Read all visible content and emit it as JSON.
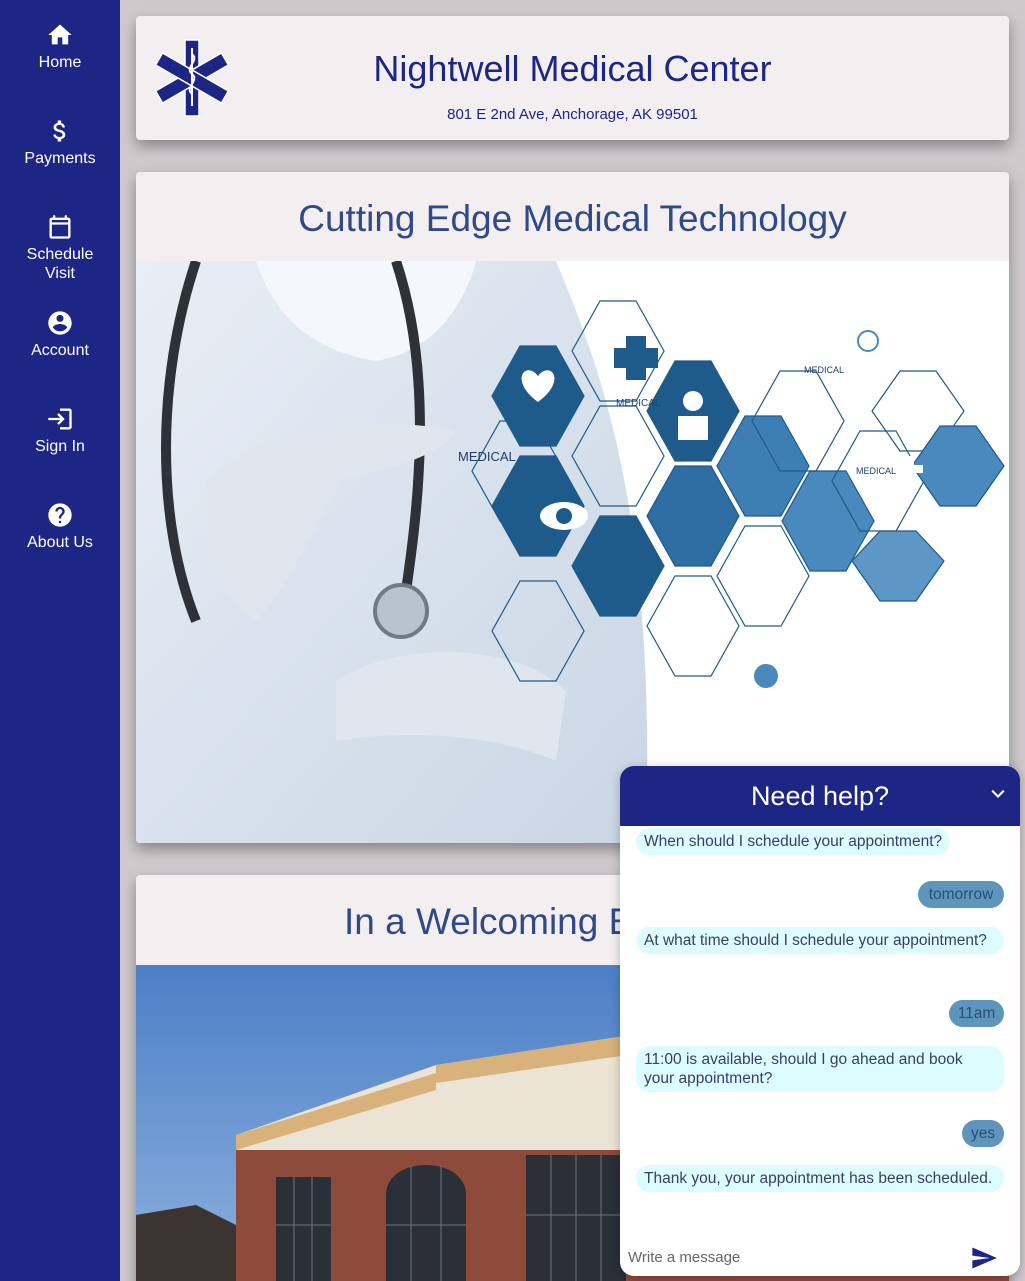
{
  "sidebar": {
    "items": [
      {
        "label": "Home",
        "icon": "home-icon"
      },
      {
        "label": "Payments",
        "icon": "dollar-icon"
      },
      {
        "label": "Schedule Visit",
        "icon": "calendar-icon"
      },
      {
        "label": "Account",
        "icon": "account-icon"
      },
      {
        "label": "Sign In",
        "icon": "sign-in-icon"
      },
      {
        "label": "About Us",
        "icon": "help-icon"
      }
    ]
  },
  "header": {
    "title": "Nightwell Medical Center",
    "address": "801 E 2nd Ave, Anchorage, AK 99501",
    "logo": "star-of-life-icon"
  },
  "sections": [
    {
      "title": "Cutting Edge Medical Technology",
      "image": "doctor-touching-medical-icons"
    },
    {
      "title": "In a Welcoming E",
      "image": "brick-medical-building"
    }
  ],
  "chat": {
    "title": "Need help?",
    "messages": [
      {
        "from": "bot",
        "text": "When should I schedule your appointment?"
      },
      {
        "from": "user",
        "text": "tomorrow"
      },
      {
        "from": "bot",
        "text": "At what time should I schedule your appointment?"
      },
      {
        "from": "user",
        "text": "11am"
      },
      {
        "from": "bot",
        "text": "11:00 is available, should I go ahead and book your appointment?"
      },
      {
        "from": "user",
        "text": "yes"
      },
      {
        "from": "bot",
        "text": "Thank you, your appointment has been scheduled."
      }
    ],
    "input_placeholder": "Write a message"
  },
  "colors": {
    "sidebar": "#1d2585",
    "background": "#cfc9cc",
    "card": "#f3eff1",
    "bot_bubble": "#dcfcff",
    "user_bubble": "#5e95bd"
  }
}
